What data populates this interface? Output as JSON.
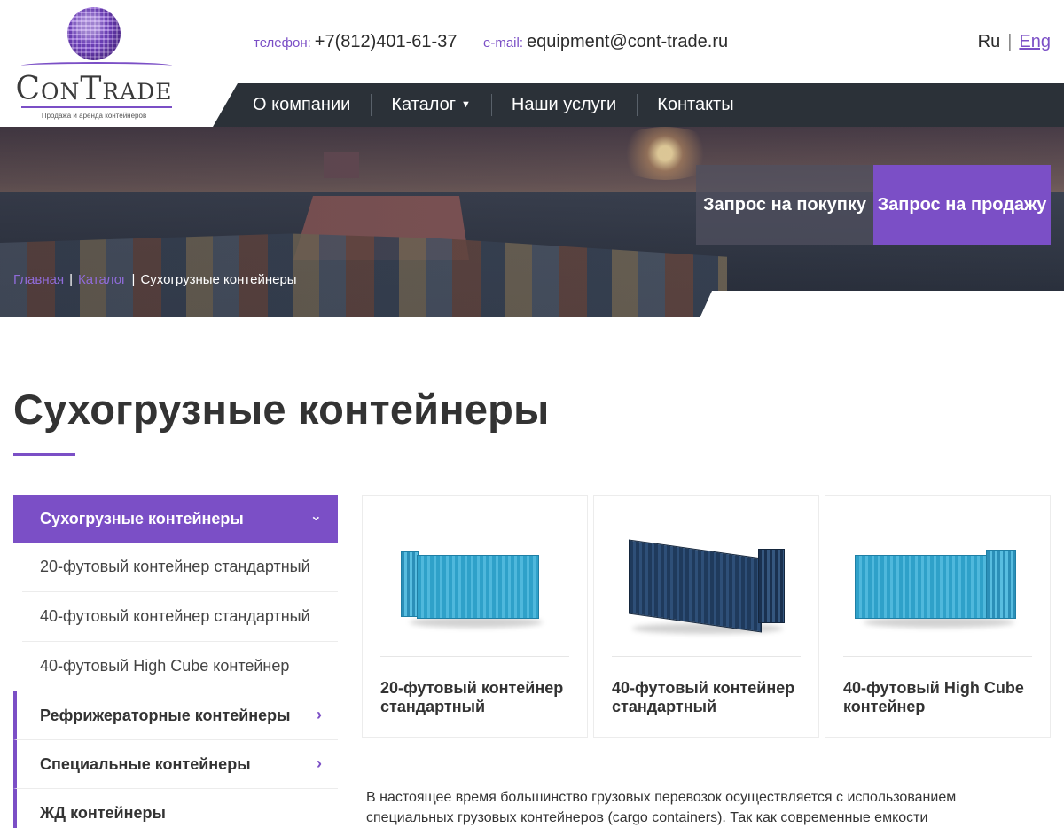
{
  "header": {
    "logo_text": "ConTrade",
    "logo_tagline": "Продажа и аренда контейнеров",
    "phone_label": "телефон:",
    "phone": "+7(812)401-61-37",
    "email_label": "e-mail:",
    "email": "equipment@cont-trade.ru",
    "lang_ru": "Ru",
    "lang_sep": "|",
    "lang_en": "Eng"
  },
  "nav": {
    "items": [
      {
        "label": "О компании"
      },
      {
        "label": "Каталог"
      },
      {
        "label": "Наши услуги"
      },
      {
        "label": "Контакты"
      }
    ],
    "catalog_caret": "▼"
  },
  "hero": {
    "breadcrumb": {
      "home": "Главная",
      "catalog": "Каталог",
      "sep": "|",
      "current": "Сухогрузные контейнеры"
    },
    "buy_request": "Запрос на покупку",
    "sell_request": "Запрос на продажу"
  },
  "page": {
    "title": "Сухогрузные контейнеры"
  },
  "sidebar": {
    "active": "Сухогрузные контейнеры",
    "active_chevron": "⌄",
    "sub_items": [
      {
        "label": "20-футовый контейнер стандартный"
      },
      {
        "label": "40-футовый контейнер стандартный"
      },
      {
        "label": "40-футовый High Cube контейнер"
      }
    ],
    "categories": [
      {
        "label": "Рефрижераторные контейнеры"
      },
      {
        "label": "Специальные контейнеры"
      },
      {
        "label": "ЖД контейнеры"
      }
    ],
    "cat_chevron": "›"
  },
  "products": [
    {
      "name": "20-футовый контейнер стандартный",
      "image": "container-20ft-blue"
    },
    {
      "name": "40-футовый контейнер стандартный",
      "image": "container-40ft-navy"
    },
    {
      "name": "40-футовый High Cube контейнер",
      "image": "container-40ft-hc-blue"
    }
  ],
  "description": "В настоящее время большинство грузовых перевозок осуществляется с использованием специальных грузовых контейнеров (cargo containers). Так как современные емкости",
  "colors": {
    "accent": "#7b4fc6",
    "nav_bg": "#2b3138",
    "text": "#333333"
  }
}
